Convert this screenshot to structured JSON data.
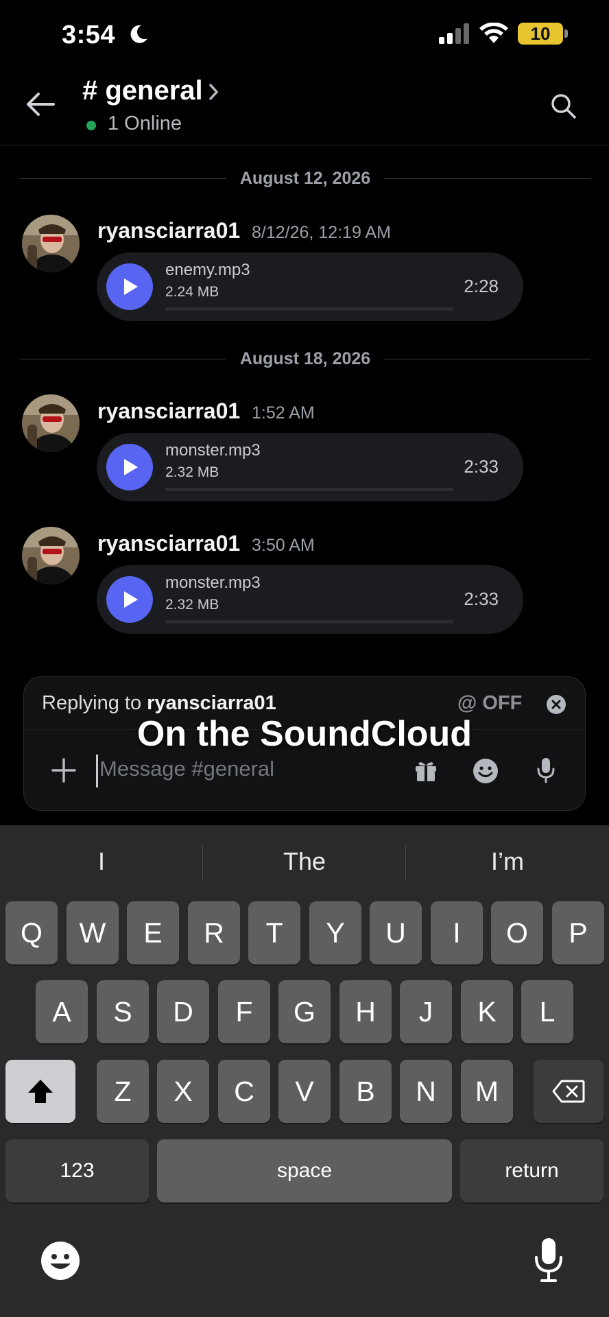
{
  "status_bar": {
    "time": "3:54",
    "battery": "10"
  },
  "header": {
    "channel": "# general",
    "online": "1 Online"
  },
  "dates": [
    "August 12, 2026",
    "August 18, 2026"
  ],
  "messages": [
    {
      "user": "ryansciarra01",
      "time": "8/12/26, 12:19 AM",
      "file": "enemy.mp3",
      "size": "2.24 MB",
      "duration": "2:28"
    },
    {
      "user": "ryansciarra01",
      "time": "1:52 AM",
      "file": "monster.mp3",
      "size": "2.32 MB",
      "duration": "2:33"
    },
    {
      "user": "ryansciarra01",
      "time": "3:50 AM",
      "file": "monster.mp3",
      "size": "2.32 MB",
      "duration": "2:33"
    }
  ],
  "composer": {
    "replying_prefix": "Replying to ",
    "replying_user": "ryansciarra01",
    "mention_toggle": "@ OFF",
    "placeholder": "Message #general"
  },
  "caption": "On the SoundCloud",
  "keyboard": {
    "suggestions": [
      "I",
      "The",
      "I’m"
    ],
    "row1": [
      "Q",
      "W",
      "E",
      "R",
      "T",
      "Y",
      "U",
      "I",
      "O",
      "P"
    ],
    "row2": [
      "A",
      "S",
      "D",
      "F",
      "G",
      "H",
      "J",
      "K",
      "L"
    ],
    "row3": [
      "Z",
      "X",
      "C",
      "V",
      "B",
      "N",
      "M"
    ],
    "numbers": "123",
    "space": "space",
    "return": "return"
  },
  "colors": {
    "accent": "#5865f2",
    "online": "#23a55a",
    "battery": "#e6c530"
  }
}
